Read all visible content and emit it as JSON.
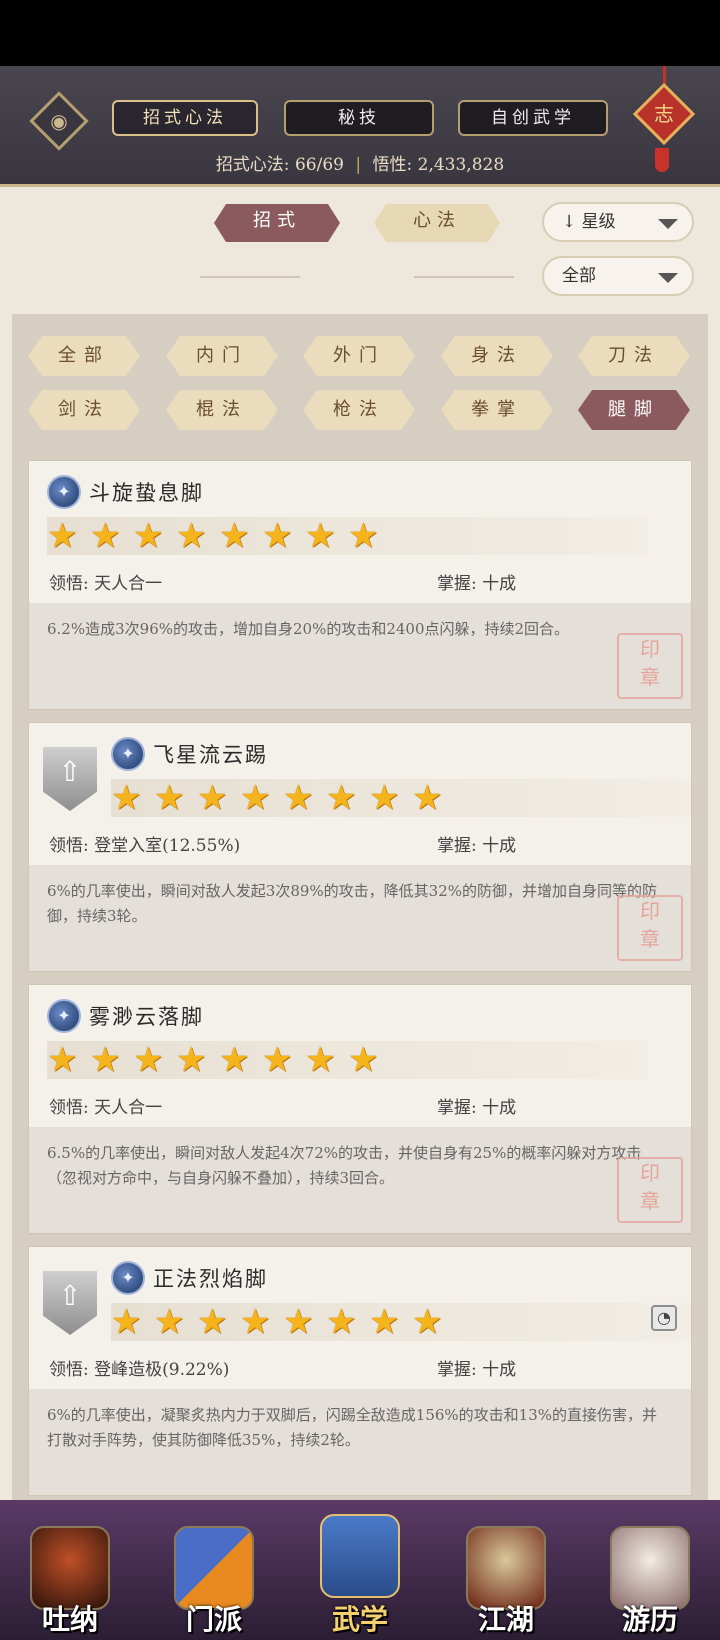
{
  "header": {
    "tabs": [
      {
        "label": "招式心法",
        "active": true
      },
      {
        "label": "秘技",
        "active": false
      },
      {
        "label": "自创武学",
        "active": false
      }
    ],
    "stats_label": "招式心法:",
    "stats_value": "66/69",
    "insight_label": "悟性:",
    "insight_value": "2,433,828",
    "badge": "志"
  },
  "category_tabs": [
    {
      "label": "招式",
      "active": true
    },
    {
      "label": "心法",
      "active": false
    }
  ],
  "sort_dropdown": {
    "value": "星级",
    "icon": "arrow-down-icon"
  },
  "filter_dropdown": {
    "value": "全部"
  },
  "filters": [
    {
      "label": "全部",
      "active": false
    },
    {
      "label": "内门",
      "active": false
    },
    {
      "label": "外门",
      "active": false
    },
    {
      "label": "身法",
      "active": false
    },
    {
      "label": "刀法",
      "active": false
    },
    {
      "label": "剑法",
      "active": false
    },
    {
      "label": "棍法",
      "active": false
    },
    {
      "label": "枪法",
      "active": false
    },
    {
      "label": "拳掌",
      "active": false
    },
    {
      "label": "腿脚",
      "active": true
    }
  ],
  "skills": [
    {
      "name": "斗旋蛰息脚",
      "stars": 8,
      "has_upgrade": false,
      "comprehension_label": "领悟:",
      "comprehension": "天人合一",
      "mastery_label": "掌握:",
      "mastery": "十成",
      "description": "6.2%造成3次96%的攻击，增加自身20%的攻击和2400点闪躲，持续2回合。"
    },
    {
      "name": "飞星流云踢",
      "stars": 8,
      "has_upgrade": true,
      "comprehension_label": "领悟:",
      "comprehension": "登堂入室(12.55%)",
      "mastery_label": "掌握:",
      "mastery": "十成",
      "description": "6%的几率使出，瞬间对敌人发起3次89%的攻击，降低其32%的防御，并增加自身同等的防御，持续3轮。"
    },
    {
      "name": "雾渺云落脚",
      "stars": 8,
      "has_upgrade": false,
      "comprehension_label": "领悟:",
      "comprehension": "天人合一",
      "mastery_label": "掌握:",
      "mastery": "十成",
      "description": "6.5%的几率使出，瞬间对敌人发起4次72%的攻击，并使自身有25%的概率闪躲对方攻击（忽视对方命中，与自身闪躲不叠加），持续3回合。"
    },
    {
      "name": "正法烈焰脚",
      "stars": 8,
      "has_upgrade": true,
      "comprehension_label": "领悟:",
      "comprehension": "登峰造极(9.22%)",
      "mastery_label": "掌握:",
      "mastery": "十成",
      "description": "6%的几率使出，凝聚炙热内力于双脚后，闪踢全敌造成156%的攻击和13%的直接伤害，并打散对手阵势，使其防御降低35%，持续2轮。"
    }
  ],
  "nav": [
    {
      "label": "吐纳",
      "active": false
    },
    {
      "label": "门派",
      "active": false
    },
    {
      "label": "武学",
      "active": true
    },
    {
      "label": "江湖",
      "active": false
    },
    {
      "label": "游历",
      "active": false
    }
  ]
}
